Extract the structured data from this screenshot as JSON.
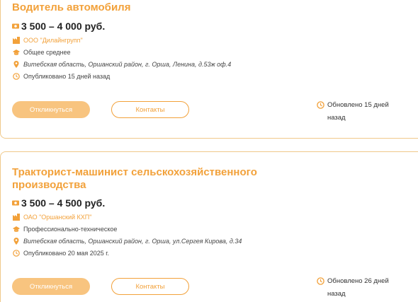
{
  "colors": {
    "accent": "#f2a13a",
    "button_fill": "#f8c47f",
    "divider": "#f0c98a"
  },
  "vacancies": [
    {
      "title": "Водитель автомобиля",
      "salary": "3 500 – 4 000 руб.",
      "company": "ООО \"Дилайнгрупп\"",
      "education": "Общее среднее",
      "address": "Витебская область, Оршанский район, г. Орша, Ленина, д.53ж оф.4",
      "published": "Опубликовано 15 дней назад",
      "apply_label": "Откликнуться",
      "contacts_label": "Контакты",
      "updated_line1": "Обновлено 15 дней",
      "updated_line2": "назад"
    },
    {
      "title": "Тракторист-машинист сельскохозяйственного производства",
      "salary": "3 500 – 4 500 руб.",
      "company": "ОАО \"Оршанский КХП\"",
      "education": "Профессионально-техническое",
      "address": "Витебская область, Оршанский район, г. Орша, ул.Сергея Кирова, д.34",
      "published": "Опубликовано 20 мая 2025 г.",
      "apply_label": "Откликнуться",
      "contacts_label": "Контакты",
      "updated_line1": "Обновлено 26 дней",
      "updated_line2": "назад"
    }
  ],
  "icons": [
    "money-icon",
    "building-icon",
    "graduation-cap-icon",
    "location-pin-icon",
    "clock-icon"
  ]
}
